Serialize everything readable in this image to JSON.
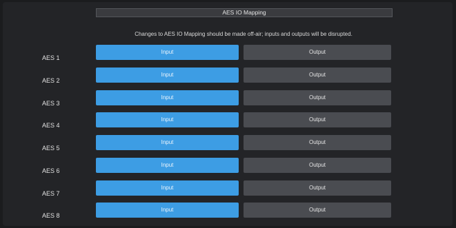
{
  "header": {
    "title": "AES IO Mapping"
  },
  "notice": "Changes to AES IO Mapping should be made off-air; inputs and outputs will be disrupted.",
  "rows": [
    {
      "label": "AES 1",
      "input_label": "Input",
      "output_label": "Output",
      "selected": "Input"
    },
    {
      "label": "AES 2",
      "input_label": "Input",
      "output_label": "Output",
      "selected": "Input"
    },
    {
      "label": "AES 3",
      "input_label": "Input",
      "output_label": "Output",
      "selected": "Input"
    },
    {
      "label": "AES 4",
      "input_label": "Input",
      "output_label": "Output",
      "selected": "Input"
    },
    {
      "label": "AES 5",
      "input_label": "Input",
      "output_label": "Output",
      "selected": "Input"
    },
    {
      "label": "AES 6",
      "input_label": "Input",
      "output_label": "Output",
      "selected": "Input"
    },
    {
      "label": "AES 7",
      "input_label": "Input",
      "output_label": "Output",
      "selected": "Input"
    },
    {
      "label": "AES 8",
      "input_label": "Input",
      "output_label": "Output",
      "selected": "Input"
    }
  ],
  "colors": {
    "background": "#1b1c1e",
    "panel": "#232427",
    "selected_accent": "#3d9de4",
    "unselected_button": "#4a4c51"
  }
}
